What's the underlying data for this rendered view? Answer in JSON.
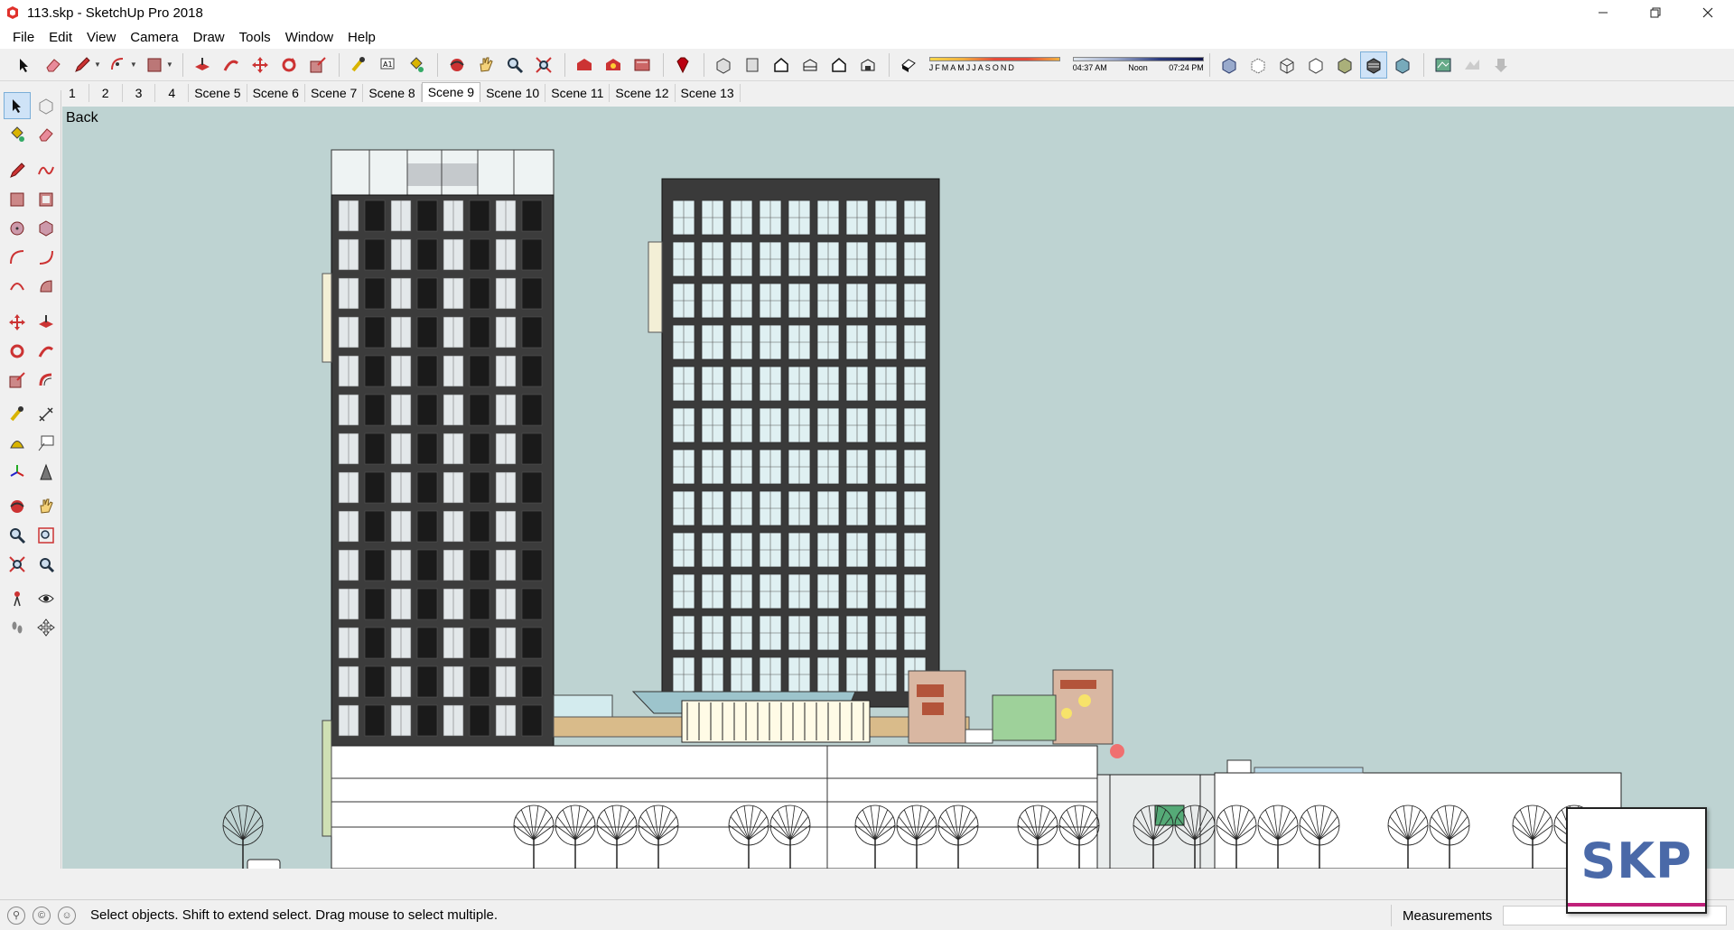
{
  "window": {
    "title": "113.skp - SketchUp Pro 2018",
    "controls": [
      "minimize",
      "restore",
      "close"
    ]
  },
  "menu": [
    "File",
    "Edit",
    "View",
    "Camera",
    "Draw",
    "Tools",
    "Window",
    "Help"
  ],
  "shadow_settings": {
    "months": [
      "J",
      "F",
      "M",
      "A",
      "M",
      "J",
      "J",
      "A",
      "S",
      "O",
      "N",
      "D"
    ],
    "time_start": "04:37 AM",
    "time_mid": "Noon",
    "time_end": "07:24 PM"
  },
  "scenes": {
    "tabs": [
      "1",
      "2",
      "3",
      "4",
      "Scene 5",
      "Scene 6",
      "Scene 7",
      "Scene 8",
      "Scene 9",
      "Scene 10",
      "Scene 11",
      "Scene 12",
      "Scene 13"
    ],
    "active": "Scene 9"
  },
  "viewport": {
    "view_label": "Back",
    "sky_color": "#bed3d2",
    "ground_color": "#d4d0bd"
  },
  "status": {
    "message": "Select objects. Shift to extend select. Drag mouse to select multiple.",
    "measurements_label": "Measurements",
    "measurements_value": ""
  },
  "logo": {
    "text": "SKP"
  },
  "colors": {
    "accent_select": "#cfe3f7",
    "logo_blue": "#4a69a8",
    "logo_magenta": "#c0207a"
  }
}
